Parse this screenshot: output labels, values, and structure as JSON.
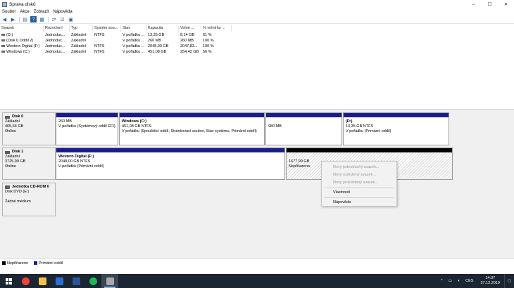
{
  "window": {
    "title": "Správa disků",
    "minimize": "─",
    "maximize": "☐",
    "close": "✕"
  },
  "menu": [
    "Soubor",
    "Akce",
    "Zobrazit",
    "Nápověda"
  ],
  "toolbar_icons": [
    "back-arrow-icon",
    "forward-arrow-icon",
    "list-view-icon",
    "help-icon",
    "properties-icon",
    "refresh-icon",
    "check-icon",
    "grid-icon"
  ],
  "volume_table": {
    "columns": [
      "Svazek",
      "Rozvržení",
      "Typ",
      "Systém sou...",
      "Stav",
      "Kapacita",
      "Volné ...",
      "% volného ..."
    ],
    "rows": [
      [
        "(D:)",
        "Jednoduc...",
        "Základní",
        "NTFS",
        "V pořádku ...",
        "13,35 GB",
        "8,14 GB",
        "61 %"
      ],
      [
        "(Disk 0 Oddíl 2)",
        "Jednoduc...",
        "Základní",
        "",
        "V pořádku ...",
        "260 MB",
        "260 MB",
        "100 %"
      ],
      [
        "Western Digital (F:)",
        "Jednoduc...",
        "Základní",
        "NTFS",
        "V pořádku ...",
        "2048,00 GB",
        "2047,83...",
        "100 %"
      ],
      [
        "Windows (C:)",
        "Jednoduc...",
        "Základní",
        "NTFS",
        "V pořádku ...",
        "451,08 GB",
        "254,42 GB",
        "56 %"
      ]
    ]
  },
  "disks": [
    {
      "name": "Disk 0",
      "type": "Základní",
      "size": "465,64 GB",
      "status": "Online",
      "partitions": [
        {
          "name": "",
          "size": "260 MB",
          "status": "V pořádku (Systémový oddíl EFI)"
        },
        {
          "name": "Windows (C:)",
          "size": "451,08 GB NTFS",
          "status": "V pořádku (Spouštěcí oddíl, Stránkovací soubor, Stav systému, Primární oddíl)"
        },
        {
          "name": "",
          "size": "980 MB",
          "status": ""
        },
        {
          "name": "(D:)",
          "size": "13,35 GB NTFS",
          "status": "V pořádku (Primární oddíl)"
        }
      ]
    },
    {
      "name": "Disk 1",
      "type": "Základní",
      "size": "3725,99 GB",
      "status": "Online",
      "partitions": [
        {
          "name": "Western Digital (F:)",
          "size": "2048,00 GB NTFS",
          "status": "V pořádku (Primární oddíl)"
        },
        {
          "name": "",
          "size": "1677,99 GB",
          "status": "Nepřiřazeno"
        }
      ]
    },
    {
      "name": "Jednotka CD-ROM 0",
      "type": "Disk DVD (E:)",
      "size": "",
      "status": "Žádné médium"
    }
  ],
  "context_menu": {
    "items": [
      {
        "label": "Nový jednoduchý svazek...",
        "disabled": true
      },
      {
        "label": "Nový rozložený svazek...",
        "disabled": true
      },
      {
        "label": "Nový prokládaný svazek...",
        "disabled": true
      },
      {
        "label": "Vlastnosti",
        "disabled": false
      },
      {
        "label": "Nápověda",
        "disabled": false
      }
    ]
  },
  "legend": [
    {
      "label": "Nepřiřazeno",
      "color": "#000000"
    },
    {
      "label": "Primární oddíl",
      "color": "#1a1b8c"
    }
  ],
  "taskbar": {
    "apps": [
      {
        "name": "chrome-icon",
        "color": "#e8453c"
      },
      {
        "name": "file-explorer-icon",
        "color": "#f2c14e"
      },
      {
        "name": "mail-icon",
        "color": "#2b6fd6"
      },
      {
        "name": "word-icon",
        "color": "#2b579a"
      },
      {
        "name": "spotify-icon",
        "color": "#1db954"
      },
      {
        "name": "disk-management-icon",
        "color": "#a9a9a9"
      }
    ],
    "tray": {
      "language": "CES",
      "time": "14:37",
      "date": "27.12.2019"
    }
  }
}
